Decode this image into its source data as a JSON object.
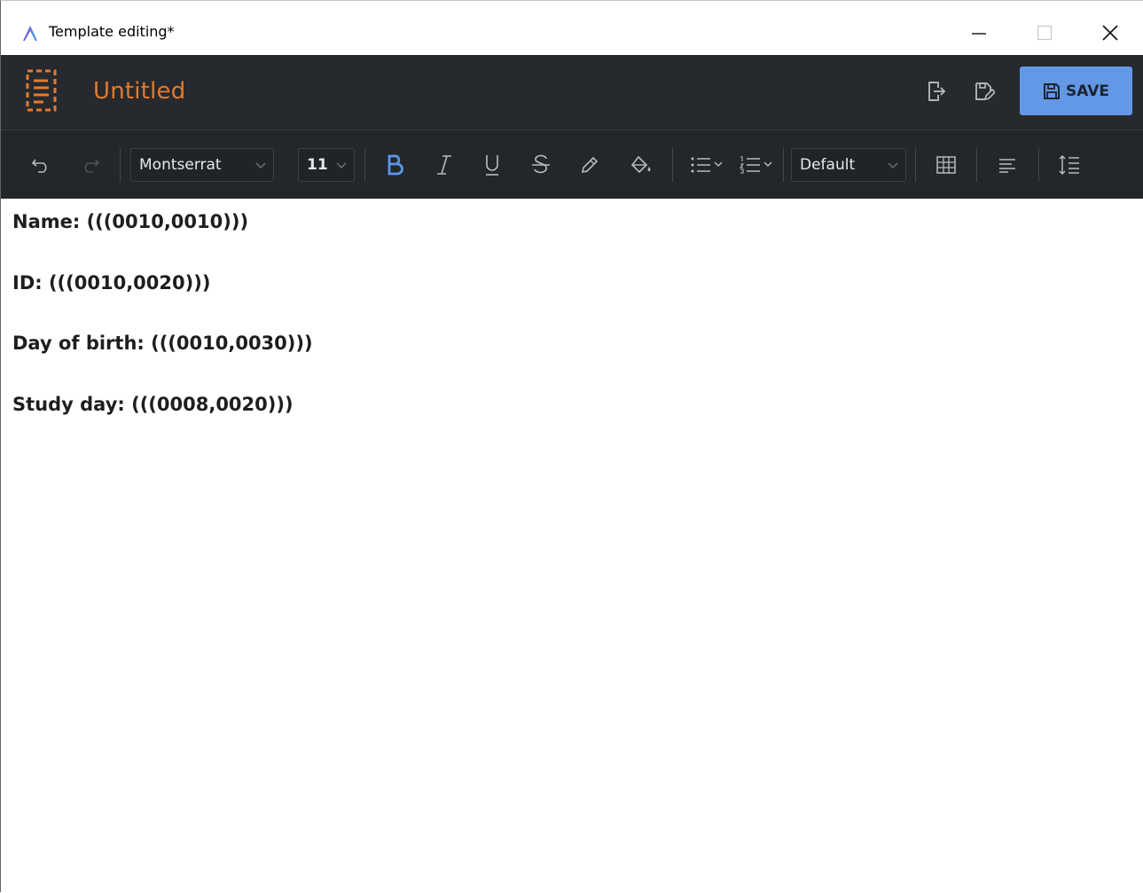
{
  "window": {
    "title": "Template editing*",
    "icon": "app-logo-icon"
  },
  "header": {
    "document_title": "Untitled",
    "document_icon": "document-icon",
    "export_icon": "export-icon",
    "save_as_icon": "save-as-icon",
    "save_label": "SAVE"
  },
  "toolbar": {
    "font_family": "Montserrat",
    "font_size": "11",
    "paragraph_style": "Default",
    "icons": [
      "undo-icon",
      "redo-icon",
      "bold-icon",
      "italic-icon",
      "underline-icon",
      "strikethrough-icon",
      "highlight-pen-icon",
      "fill-color-icon",
      "bullet-list-icon",
      "numbered-list-icon",
      "table-icon",
      "align-left-icon",
      "line-spacing-icon"
    ]
  },
  "document": {
    "lines": [
      "Name: (((0010,0010)))",
      "ID: (((0010,0020)))",
      "Day of birth: (((0010,0030)))",
      "Study day: (((0008,0020)))"
    ]
  },
  "colors": {
    "header_bg": "#262a2e",
    "toolbar_bg": "#23272b",
    "title_accent": "#e57a2c",
    "save_button": "#6398e6",
    "bold_active": "#5b97e8"
  }
}
